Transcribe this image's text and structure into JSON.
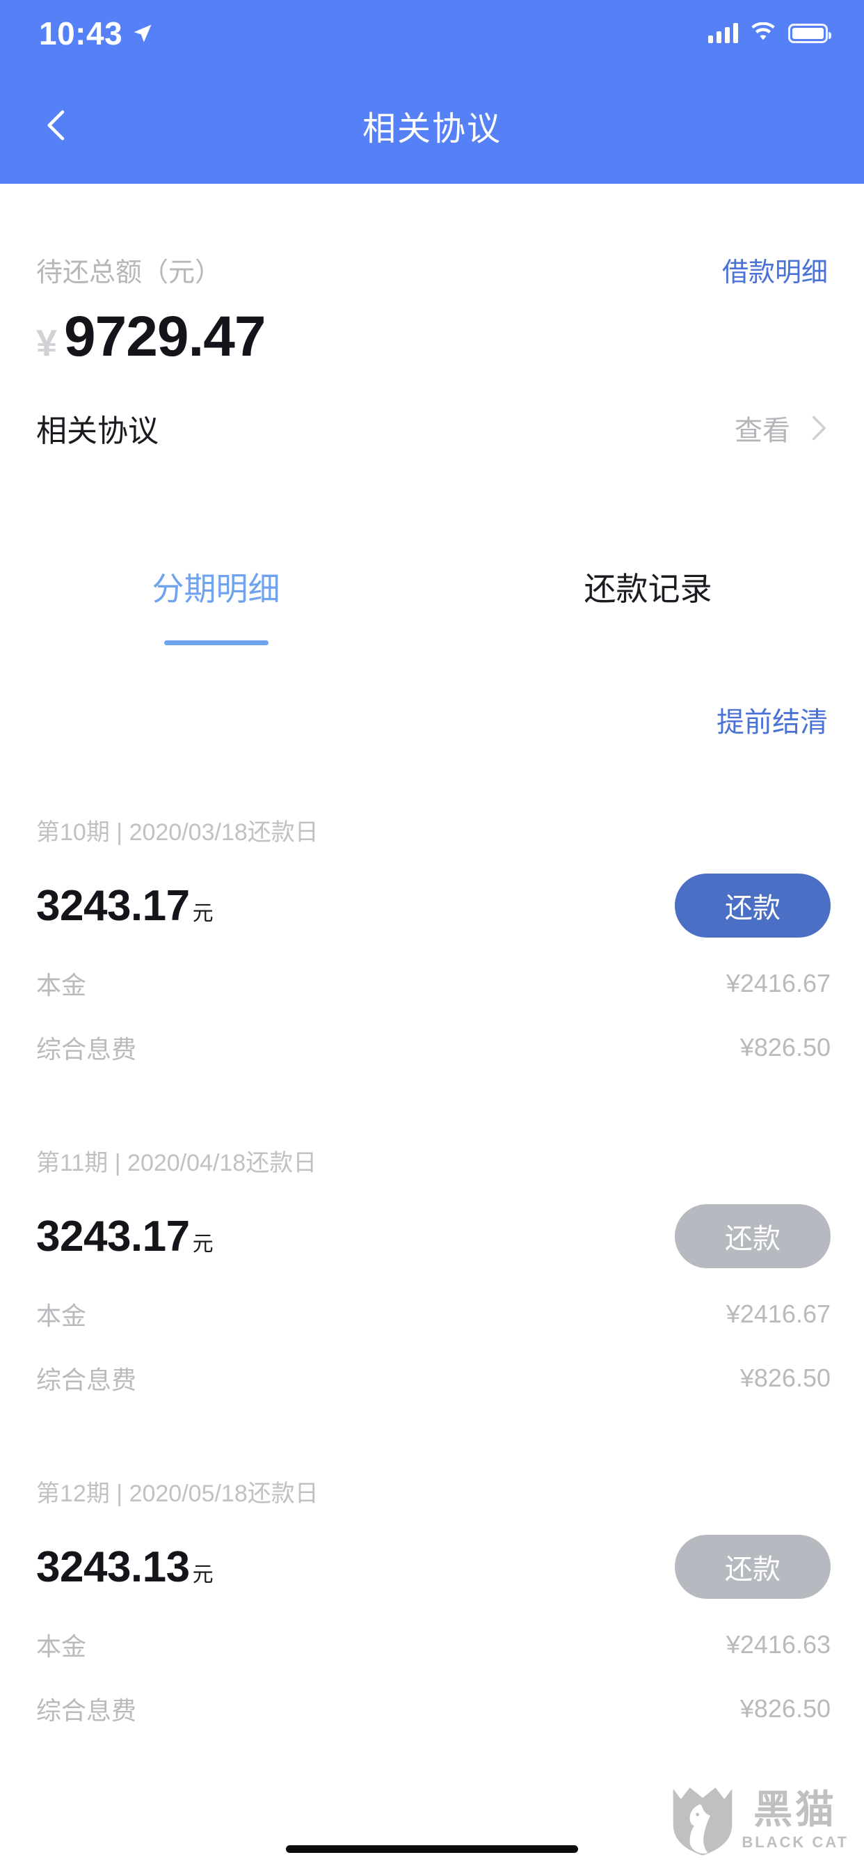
{
  "status_bar": {
    "time": "10:43",
    "location_icon": "location-arrow-icon",
    "signal_icon": "cellular-signal-icon",
    "wifi_icon": "wifi-icon",
    "battery_icon": "battery-icon"
  },
  "nav": {
    "back_icon": "chevron-left-icon",
    "title": "相关协议"
  },
  "summary": {
    "total_label": "待还总额（元）",
    "detail_link": "借款明细",
    "currency_symbol": "¥",
    "total_amount": "9729.47",
    "agreement_title": "相关协议",
    "agreement_action": "查看",
    "agreement_chevron_icon": "chevron-right-icon"
  },
  "tabs": [
    {
      "label": "分期明细",
      "active": true
    },
    {
      "label": "还款记录",
      "active": false
    }
  ],
  "settle_link": "提前结清",
  "installments": [
    {
      "period": "第10期",
      "separator": "|",
      "due_date": "2020/03/18还款日",
      "amount": "3243.17",
      "amount_unit": "元",
      "button_label": "还款",
      "button_enabled": true,
      "rows": [
        {
          "label": "本金",
          "value": "¥2416.67"
        },
        {
          "label": "综合息费",
          "value": "¥826.50"
        }
      ]
    },
    {
      "period": "第11期",
      "separator": "|",
      "due_date": "2020/04/18还款日",
      "amount": "3243.17",
      "amount_unit": "元",
      "button_label": "还款",
      "button_enabled": false,
      "rows": [
        {
          "label": "本金",
          "value": "¥2416.67"
        },
        {
          "label": "综合息费",
          "value": "¥826.50"
        }
      ]
    },
    {
      "period": "第12期",
      "separator": "|",
      "due_date": "2020/05/18还款日",
      "amount": "3243.13",
      "amount_unit": "元",
      "button_label": "还款",
      "button_enabled": false,
      "rows": [
        {
          "label": "本金",
          "value": "¥2416.63"
        },
        {
          "label": "综合息费",
          "value": "¥826.50"
        }
      ]
    }
  ],
  "watermark": {
    "shield_icon": "black-cat-shield-icon",
    "cn": "黑猫",
    "en": "BLACK CAT"
  },
  "colors": {
    "header_blue": "#5680f5",
    "link_blue": "#4a72d6",
    "tab_active": "#6fa3f0",
    "button_enabled": "#4a6fc4",
    "button_disabled": "#b6bac0"
  }
}
